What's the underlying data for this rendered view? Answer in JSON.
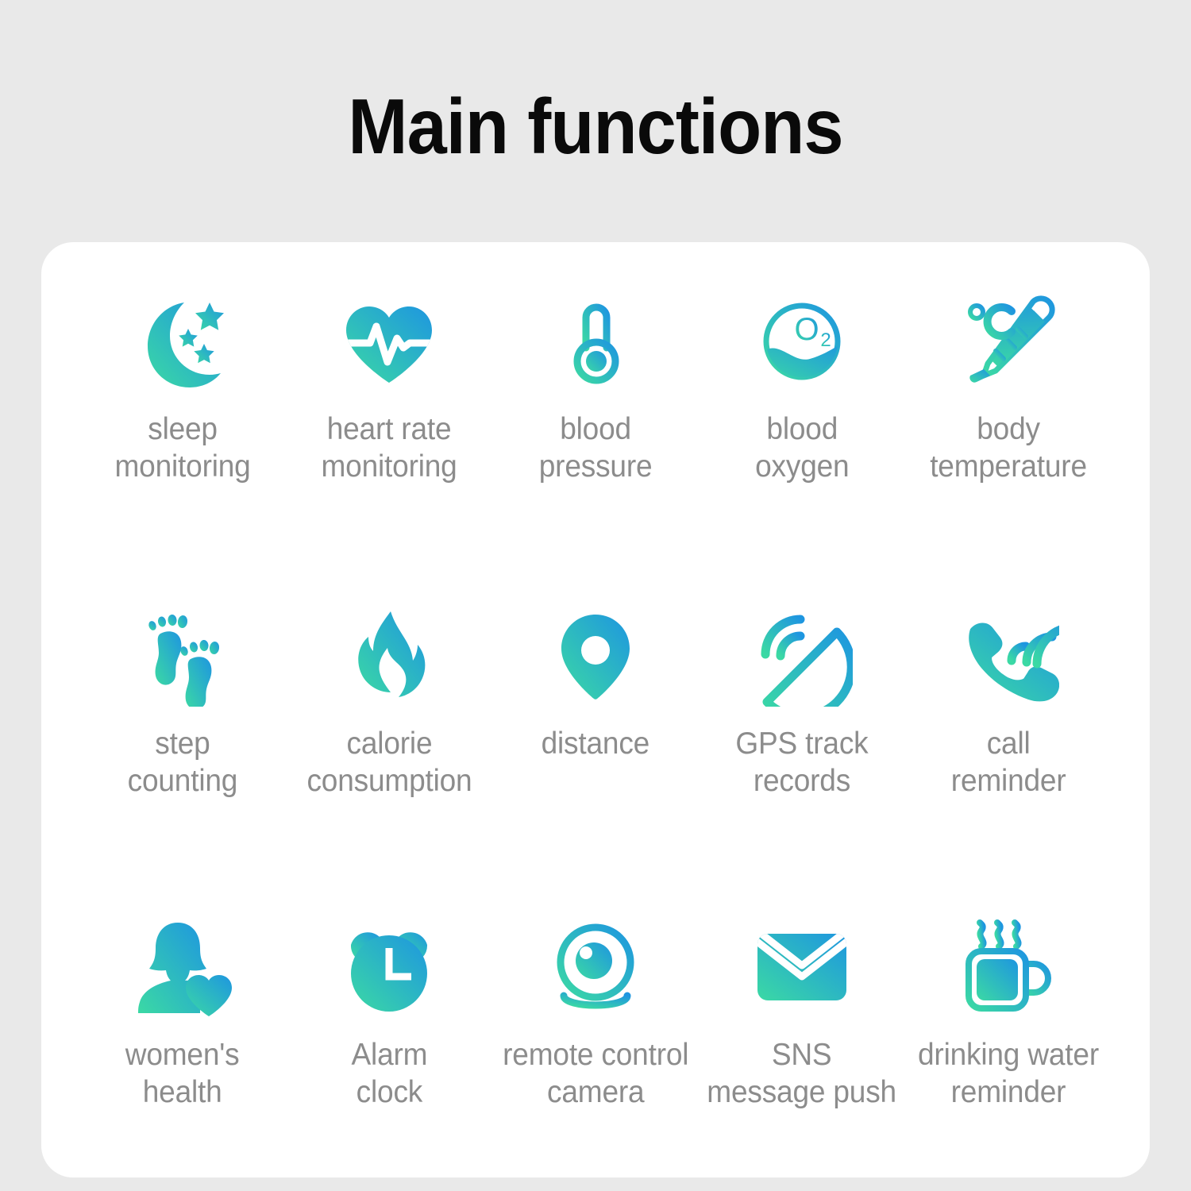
{
  "header": {
    "title": "Main functions"
  },
  "colors": {
    "background": "#e9e9e9",
    "card": "#ffffff",
    "title_text": "#0a0a0a",
    "label_text": "#8c8c8c",
    "gradient_blue": "#1E96E0",
    "gradient_teal": "#3BD9A4"
  },
  "grid": {
    "rows": [
      {
        "cells": [
          {
            "icon": "moon-stars-icon",
            "label": "sleep\nmonitoring"
          },
          {
            "icon": "heart-pulse-icon",
            "label": "heart rate\nmonitoring"
          },
          {
            "icon": "thermometer-gauge-icon",
            "label": "blood\npressure"
          },
          {
            "icon": "o2-droplet-circle-icon",
            "label": "blood\noxygen"
          },
          {
            "icon": "clinical-thermometer-celsius-icon",
            "label": "body\ntemperature"
          }
        ]
      },
      {
        "cells": [
          {
            "icon": "footprints-icon",
            "label": "step\ncounting"
          },
          {
            "icon": "flame-icon",
            "label": "calorie\nconsumption"
          },
          {
            "icon": "map-pin-icon",
            "label": "distance"
          },
          {
            "icon": "satellite-dish-icon",
            "label": "GPS track\nrecords"
          },
          {
            "icon": "phone-ringing-icon",
            "label": "call\nreminder"
          }
        ]
      },
      {
        "cells": [
          {
            "icon": "woman-heart-icon",
            "label": "women's\nhealth"
          },
          {
            "icon": "alarm-clock-icon",
            "label": "Alarm\nclock"
          },
          {
            "icon": "webcam-icon",
            "label": "remote control\ncamera"
          },
          {
            "icon": "envelope-icon",
            "label": "SNS\nmessage push"
          },
          {
            "icon": "hot-mug-icon",
            "label": "drinking water\nreminder"
          }
        ]
      }
    ]
  }
}
